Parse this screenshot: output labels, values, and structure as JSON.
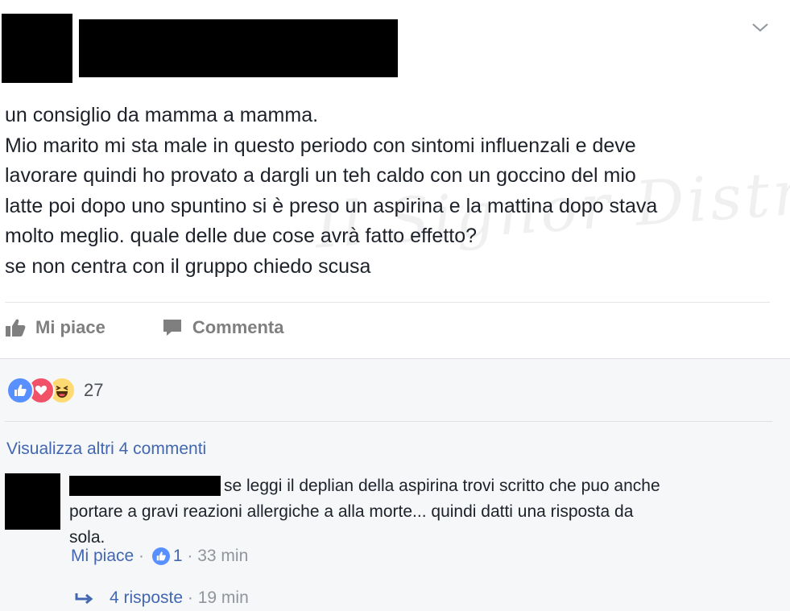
{
  "post": {
    "menu_icon": "chevron-down-icon",
    "text_lines": [
      "un consiglio da mamma a mamma.",
      "Mio marito mi sta male in questo periodo con sintomi influenzali e deve",
      "lavorare quindi ho provato a dargli un teh caldo con un goccino del mio",
      "latte poi dopo uno spuntino si è preso un aspirina e la mattina dopo stava",
      "molto meglio. quale delle due cose avrà fatto effetto?",
      "se non centra con il gruppo chiedo scusa"
    ],
    "watermark": "Il Signor Distruggere",
    "actions": {
      "like": "Mi piace",
      "comment": "Commenta"
    }
  },
  "reactions": {
    "count": "27",
    "icons": [
      "like-reaction-icon",
      "love-reaction-icon",
      "haha-reaction-icon"
    ]
  },
  "comments": {
    "view_more": "Visualizza altri 4 commenti",
    "items": [
      {
        "text_line1": "se leggi il deplian della aspirina trovi scritto che puo anche",
        "text_line2": "portare a gravi reazioni allergiche a alla morte... quindi datti una risposta da",
        "text_line3": "sola.",
        "like_label": "Mi piace",
        "like_count": "1",
        "time": "33 min",
        "replies_label": "4 risposte",
        "replies_time": "19 min"
      }
    ]
  },
  "colors": {
    "link": "#4267b2",
    "meta": "#90949c",
    "footer_bg": "#f6f7f9",
    "like": "#5890ff",
    "love": "#f25268",
    "haha": "#ffd972"
  }
}
